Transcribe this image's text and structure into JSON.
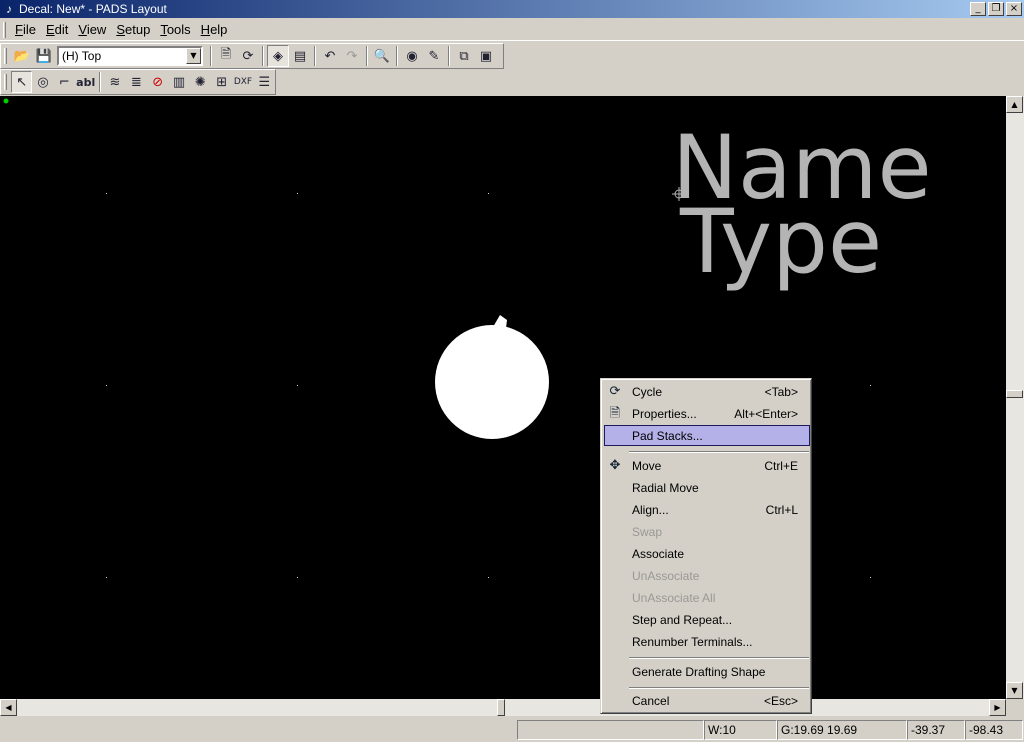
{
  "window": {
    "title": "Decal: New* - PADS Layout",
    "app_icon": "pads-app-icon",
    "minimize_glyph": "_",
    "restore_glyph": "❐",
    "close_glyph": "×"
  },
  "menubar": {
    "items": [
      {
        "label": "File",
        "key": "F",
        "rest": "ile"
      },
      {
        "label": "Edit",
        "key": "E",
        "rest": "dit"
      },
      {
        "label": "View",
        "key": "V",
        "rest": "iew"
      },
      {
        "label": "Setup",
        "key": "S",
        "rest": "etup"
      },
      {
        "label": "Tools",
        "key": "T",
        "rest": "ools"
      },
      {
        "label": "Help",
        "key": "H",
        "rest": "elp"
      }
    ]
  },
  "toolbar1": {
    "layer_select_value": "(H) Top",
    "icons": [
      "open-icon",
      "save-icon",
      "properties-icon",
      "cycle-icon",
      "layer-view-icon",
      "print-preview-icon",
      "undo-icon",
      "redo-icon",
      "zoom-icon",
      "view-icon",
      "brush-icon",
      "decal-editor-icon",
      "window-icon"
    ]
  },
  "toolbar2": {
    "icons": [
      "select-icon",
      "terminal-icon",
      "drafting-icon",
      "text-icon",
      "layer-2d-icon",
      "copper-icon",
      "wizard-icon",
      "decal-icon",
      "pad-icon",
      "step-icon",
      "dxf-icon",
      "list-icon"
    ]
  },
  "canvas": {
    "background": "#000000",
    "decal_text_line1": "Name",
    "decal_text_line2": "Type",
    "text_color": "#b4b4b4",
    "pad_color": "#ffffff",
    "origin_marker_color": "#00cc00"
  },
  "context_menu": {
    "items": [
      {
        "label": "Cycle",
        "shortcut": "<Tab>",
        "icon": "cycle-icon",
        "disabled": false
      },
      {
        "label": "Properties...",
        "shortcut": "Alt+<Enter>",
        "icon": "properties-icon",
        "disabled": false
      },
      {
        "label": "Pad Stacks...",
        "shortcut": "",
        "icon": "",
        "disabled": false,
        "highlighted": true
      },
      {
        "label": "Move",
        "shortcut": "Ctrl+E",
        "icon": "move-icon",
        "disabled": false
      },
      {
        "label": "Radial Move",
        "shortcut": "",
        "icon": "",
        "disabled": false
      },
      {
        "label": "Align...",
        "shortcut": "Ctrl+L",
        "icon": "",
        "disabled": false
      },
      {
        "label": "Swap",
        "shortcut": "",
        "icon": "",
        "disabled": true
      },
      {
        "label": "Associate",
        "shortcut": "",
        "icon": "",
        "disabled": false
      },
      {
        "label": "UnAssociate",
        "shortcut": "",
        "icon": "",
        "disabled": true
      },
      {
        "label": "UnAssociate All",
        "shortcut": "",
        "icon": "",
        "disabled": true
      },
      {
        "label": "Step and Repeat...",
        "shortcut": "",
        "icon": "",
        "disabled": false
      },
      {
        "label": "Renumber Terminals...",
        "shortcut": "",
        "icon": "",
        "disabled": false
      },
      {
        "label": "Generate Drafting Shape",
        "shortcut": "",
        "icon": "",
        "disabled": false
      },
      {
        "label": "Cancel",
        "shortcut": "<Esc>",
        "icon": "",
        "disabled": false
      }
    ]
  },
  "statusbar": {
    "width": "W:10",
    "grid": "G:19.69 19.69",
    "x": "-39.37",
    "y": "-98.43"
  }
}
